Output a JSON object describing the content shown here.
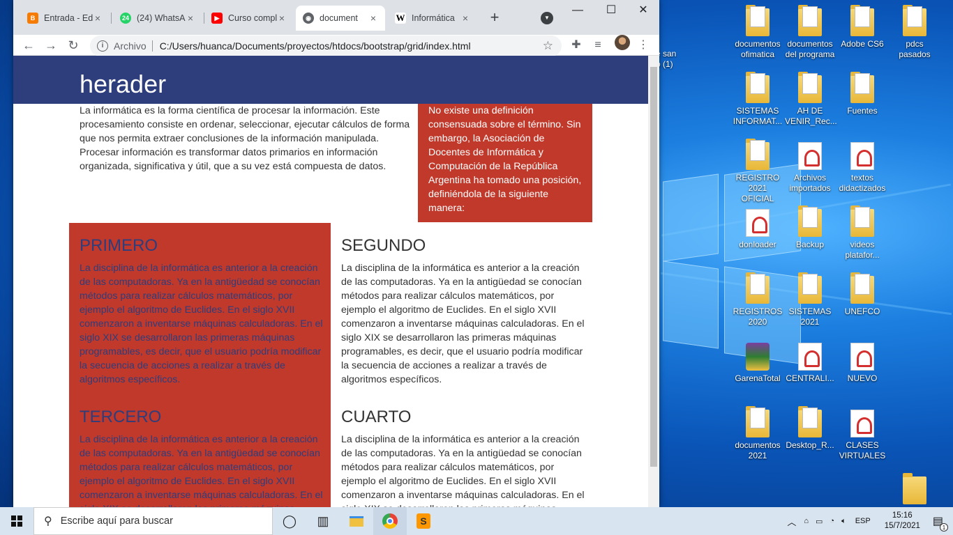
{
  "browser": {
    "tabs": [
      {
        "label": "Entrada - Ed",
        "icon": "blogger-icon",
        "color": "#f57c00",
        "glyph": "B"
      },
      {
        "label": "(24) WhatsAp",
        "icon": "whatsapp-icon",
        "color": "#25d366",
        "glyph": "24"
      },
      {
        "label": "Curso compl",
        "icon": "youtube-icon",
        "color": "#ff0000",
        "glyph": "▶"
      },
      {
        "label": "document",
        "icon": "globe-icon",
        "color": "#5f6368",
        "glyph": "◉"
      },
      {
        "label": "Informática",
        "icon": "wikipedia-icon",
        "color": "#ffffff",
        "glyph": "W"
      }
    ],
    "new_tab": "+",
    "address": {
      "scheme_label": "Archivo",
      "url": "C:/Users/huanca/Documents/proyectos/htdocs/bootstrap/grid/index.html"
    }
  },
  "page": {
    "header_title": "herader",
    "intro": "La informática es la forma científica de procesar la información. Este procesamiento consiste en ordenar, seleccionar, ejecutar cálculos de forma que nos permita extraer conclusiones de la información manipulada. Procesar información es transformar datos primarios en información organizada, significativa y útil, que a su vez está compuesta de datos.",
    "aside": "No existe una definición consensuada sobre el término. Sin embargo, la Asociación de Docentes de Informática y Computación de la República Argentina ha tomado una posición, definiéndola de la siguiente manera:",
    "cards": [
      {
        "title": "PRIMERO",
        "text": "La disciplina de la informática es anterior a la creación de las computadoras. Ya en la antigüedad se conocían métodos para realizar cálculos matemáticos, por ejemplo el algoritmo de Euclides. En el siglo XVII comenzaron a inventarse máquinas calculadoras. En el siglo XIX se desarrollaron las primeras máquinas programables, es decir, que el usuario podría modificar la secuencia de acciones a realizar a través de algoritmos específicos."
      },
      {
        "title": "SEGUNDO",
        "text": "La disciplina de la informática es anterior a la creación de las computadoras. Ya en la antigüedad se conocían métodos para realizar cálculos matemáticos, por ejemplo el algoritmo de Euclides. En el siglo XVII comenzaron a inventarse máquinas calculadoras. En el siglo XIX se desarrollaron las primeras máquinas programables, es decir, que el usuario podría modificar la secuencia de acciones a realizar a través de algoritmos específicos."
      },
      {
        "title": "TERCERO",
        "text": "La disciplina de la informática es anterior a la creación de las computadoras. Ya en la antigüedad se conocían métodos para realizar cálculos matemáticos, por ejemplo el algoritmo de Euclides. En el siglo XVII comenzaron a inventarse máquinas calculadoras. En el siglo XIX se desarrollaron las primeras máquinas programables, es decir, que el usuario podría modificar la secuencia de acciones a realizar a través de algoritmos específicos."
      },
      {
        "title": "CUARTO",
        "text": "La disciplina de la informática es anterior a la creación de las computadoras. Ya en la antigüedad se conocían métodos para realizar cálculos matemáticos, por ejemplo el algoritmo de Euclides. En el siglo XVII comenzaron a inventarse máquinas calculadoras. En el siglo XIX se desarrollaron las primeras máquinas programables, es decir, que el usuario podría modificar la secuencia de acciones a realizar a través de algoritmos específicos."
      }
    ],
    "colors": {
      "header": "#2e3d7c",
      "accent_red": "#c0392b"
    }
  },
  "desktop": {
    "partial_icon_label": "e san\nb (1)",
    "icons": [
      {
        "label": "documentos ofimatica",
        "type": "folder"
      },
      {
        "label": "documentos del programa",
        "type": "folder"
      },
      {
        "label": "Adobe CS6",
        "type": "folder"
      },
      {
        "label": "pdcs pasados",
        "type": "folder"
      },
      {
        "label": "SISTEMAS INFORMAT...",
        "type": "folder"
      },
      {
        "label": "AH DE VENIR_Rec...",
        "type": "folder"
      },
      {
        "label": "Fuentes",
        "type": "folder"
      },
      {
        "label": "REGISTRO 2021 OFICIAL",
        "type": "folder"
      },
      {
        "label": "Archivos importados",
        "type": "pdf"
      },
      {
        "label": "textos didactizados",
        "type": "pdf"
      },
      {
        "label": "donloader",
        "type": "pdf"
      },
      {
        "label": "Backup",
        "type": "folder"
      },
      {
        "label": "videos platafor...",
        "type": "folder"
      },
      {
        "label": "REGISTROS 2020",
        "type": "folder"
      },
      {
        "label": "SISTEMAS 2021",
        "type": "folder"
      },
      {
        "label": "UNEFCO",
        "type": "folder"
      },
      {
        "label": "GarenaTotal",
        "type": "app"
      },
      {
        "label": "CENTRALI...",
        "type": "pdf"
      },
      {
        "label": "NUEVO",
        "type": "pdf"
      },
      {
        "label": "documentos 2021",
        "type": "folder"
      },
      {
        "label": "Desktop_R...",
        "type": "folder"
      },
      {
        "label": "CLASES VIRTUALES",
        "type": "pdf"
      }
    ]
  },
  "taskbar": {
    "search_placeholder": "Escribe aquí para buscar",
    "language": "ESP",
    "time": "15:16",
    "date": "15/7/2021",
    "notification_count": "1"
  }
}
